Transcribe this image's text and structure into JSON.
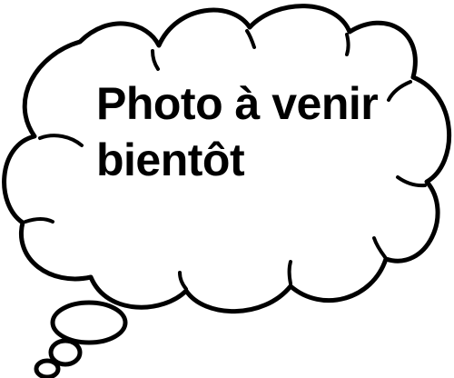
{
  "placeholder": {
    "line1": "Photo à venir",
    "line2": "bientôt"
  },
  "colors": {
    "background": "#ffffff",
    "outline": "#000000",
    "text": "#000000"
  },
  "icon": "thought-bubble-icon"
}
